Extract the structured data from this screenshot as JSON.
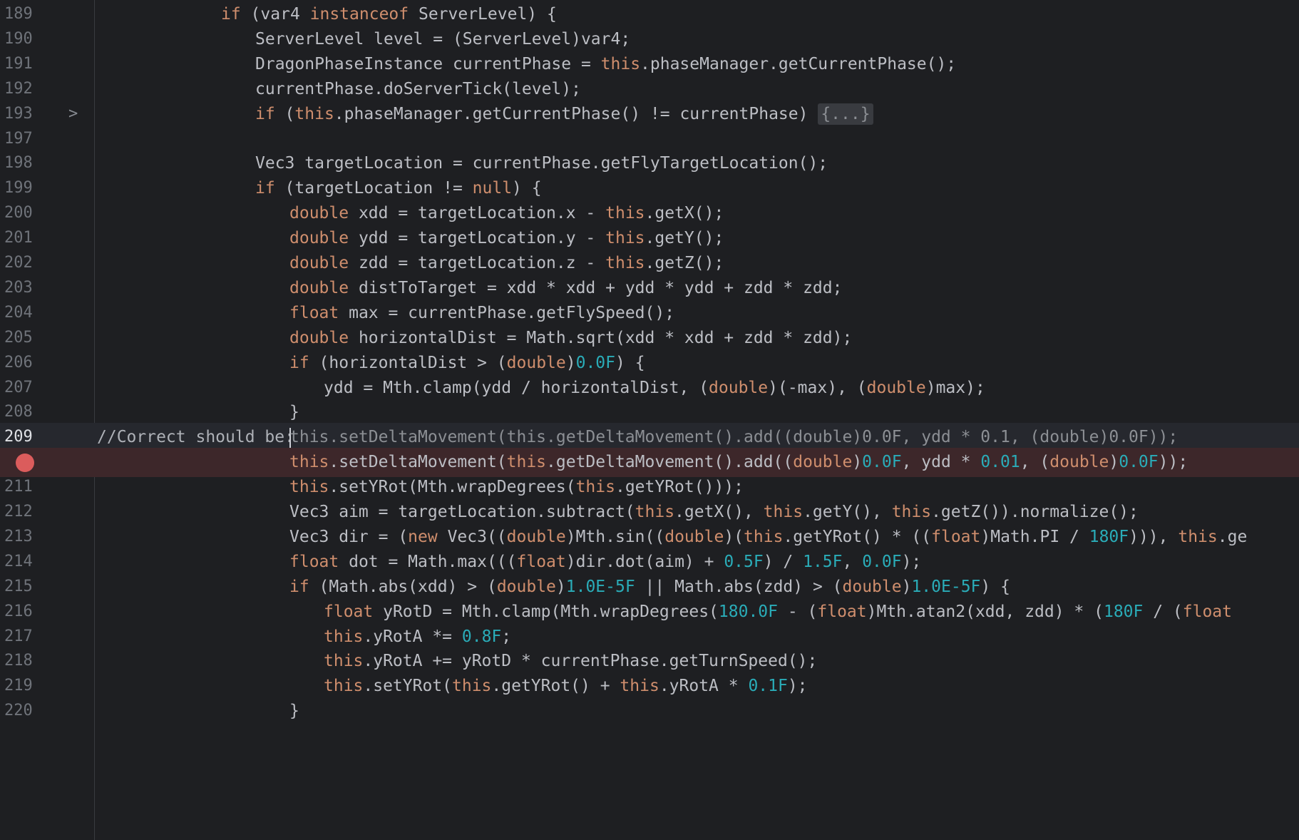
{
  "editor": {
    "colors": {
      "background": "#1e1f22",
      "keyword": "#cf8e6d",
      "number": "#2aacb8",
      "text": "#bcbec4",
      "line_number": "#6f737a",
      "breakpoint": "#db5c5c",
      "breakpoint_line": "#3d272a"
    },
    "fold_icon": "chevron-right-icon",
    "breakpoint_icon": "breakpoint-icon",
    "line_numbers": {
      "l189": "189",
      "l190": "190",
      "l191": "191",
      "l192": "192",
      "l193": "193",
      "l197": "197",
      "l198": "198",
      "l199": "199",
      "l200": "200",
      "l201": "201",
      "l202": "202",
      "l203": "203",
      "l204": "204",
      "l205": "205",
      "l206": "206",
      "l207": "207",
      "l208": "208",
      "l209": "209",
      "l211": "211",
      "l212": "212",
      "l213": "213",
      "l214": "214",
      "l215": "215",
      "l216": "216",
      "l217": "217",
      "l218": "218",
      "l219": "219",
      "l220": "220"
    },
    "fold_marker": ">",
    "tokens": {
      "if": "if",
      "instanceof": "instanceof",
      "this": "this",
      "null": "null",
      "double": "double",
      "float": "float",
      "new": "new",
      "n_0_0F": "0.0F",
      "n_0_01": "0.01",
      "n_180F": "180F",
      "n_0_5F": "0.5F",
      "n_1_5F": "1.5F",
      "n_1_0E_5F": "1.0E-5F",
      "n_180_0F": "180.0F",
      "n_0_8F": "0.8F",
      "n_0_1F": "0.1F"
    },
    "text": {
      "l189_a": " (var4 ",
      "l189_b": " ServerLevel) {",
      "l190": "ServerLevel level = (ServerLevel)var4;",
      "l191_a": "DragonPhaseInstance currentPhase = ",
      "l191_b": ".phaseManager.getCurrentPhase();",
      "l192": "currentPhase.doServerTick(level);",
      "l193_a": " (",
      "l193_b": ".phaseManager.getCurrentPhase() != currentPhase) ",
      "l193_folded": "{...}",
      "l198": "Vec3 targetLocation = currentPhase.getFlyTargetLocation();",
      "l199_a": " (targetLocation != ",
      "l199_b": ") {",
      "l200_a": " xdd = targetLocation.x - ",
      "l200_b": ".getX();",
      "l201_a": " ydd = targetLocation.y - ",
      "l201_b": ".getY();",
      "l202_a": " zdd = targetLocation.z - ",
      "l202_b": ".getZ();",
      "l203": " distToTarget = xdd * xdd + ydd * ydd + zdd * zdd;",
      "l204": " max = currentPhase.getFlySpeed();",
      "l205": " horizontalDist = Math.sqrt(xdd * xdd + zdd * zdd);",
      "l206_a": " (horizontalDist > (",
      "l206_b": ")",
      "l206_c": ") {",
      "l207_a": "ydd = Mth.clamp(ydd / horizontalDist, (",
      "l207_b": ")(-max), (",
      "l207_c": ")max);",
      "l208": "}",
      "l209_comment": "//Correct should be:",
      "l209_code": "this.setDeltaMovement(this.getDeltaMovement().add((double)0.0F, ydd * 0.1, (double)0.0F));",
      "l210_a": ".setDeltaMovement(",
      "l210_b": ".getDeltaMovement().add((",
      "l210_c": ")",
      "l210_d": ", ydd * ",
      "l210_e": ", (",
      "l210_f": ")",
      "l210_g": "));",
      "l211_a": ".setYRot(Mth.wrapDegrees(",
      "l211_b": ".getYRot()));",
      "l212_a": "Vec3 aim = targetLocation.subtract(",
      "l212_b": ".getX(), ",
      "l212_c": ".getY(), ",
      "l212_d": ".getZ()).normalize();",
      "l213_a": "Vec3 dir = (",
      "l213_b": " Vec3((",
      "l213_c": ")Mth.sin((",
      "l213_d": ")(",
      "l213_e": ".getYRot() * ((",
      "l213_f": ")Math.PI / ",
      "l213_g": "))), ",
      "l213_h": ".ge",
      "l214_a": " dot = Math.max(((",
      "l214_b": ")dir.dot(aim) + ",
      "l214_c": ") / ",
      "l214_d": ", ",
      "l214_e": ");",
      "l215_a": " (Math.abs(xdd) > (",
      "l215_b": ")",
      "l215_c": " || Math.abs(zdd) > (",
      "l215_d": ")",
      "l215_e": ") {",
      "l216_a": " yRotD = Mth.clamp(Mth.wrapDegrees(",
      "l216_b": " - (",
      "l216_c": ")Mth.atan2(xdd, zdd) * (",
      "l216_d": " / (",
      "l217_a": ".yRotA *= ",
      "l217_b": ";",
      "l218_a": ".yRotA += yRotD * currentPhase.getTurnSpeed();",
      "l219_a": ".setYRot(",
      "l219_b": ".getYRot() + ",
      "l219_c": ".yRotA * ",
      "l219_d": ");",
      "l220": "}"
    }
  }
}
